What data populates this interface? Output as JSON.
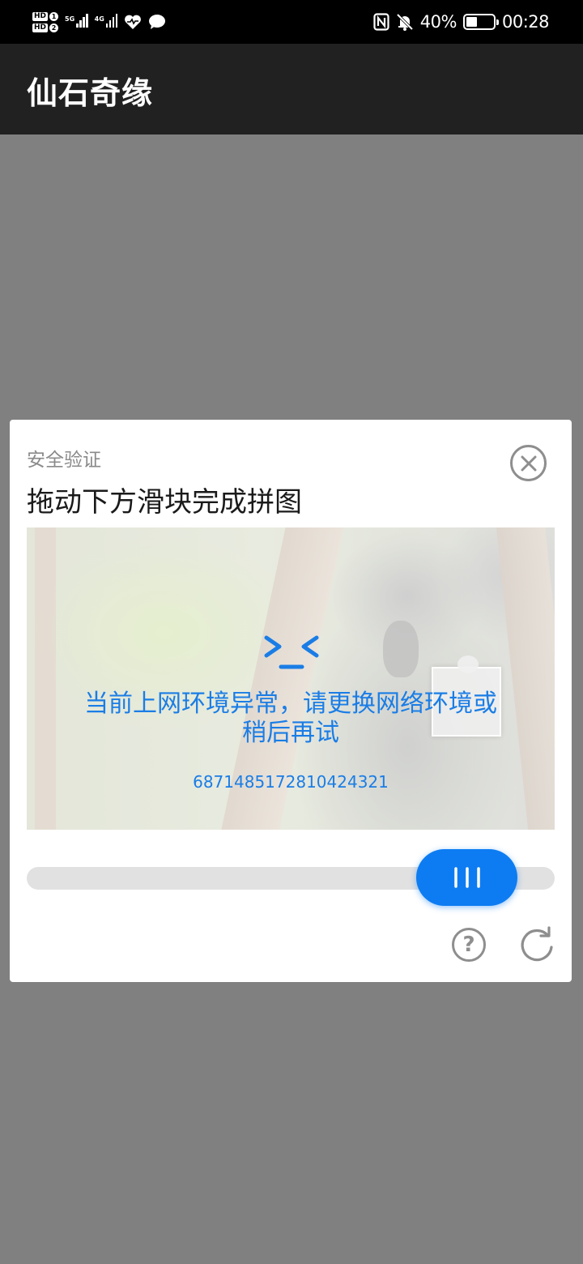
{
  "status_bar": {
    "sim1_label": "HD",
    "sim1_index": "1",
    "sim2_label": "HD",
    "sim2_index": "2",
    "network1": "5G",
    "network2": "4G",
    "icons": [
      "hd-sim-icon",
      "signal-icon",
      "heart-health-icon",
      "chat-bubble-icon",
      "nfc-icon",
      "bell-muted-icon",
      "battery-icon"
    ],
    "battery_percent": "40%",
    "battery_level": 0.4,
    "time": "00:28"
  },
  "app_bar": {
    "title": "仙石奇缘"
  },
  "dialog": {
    "subtitle": "安全验证",
    "title": "拖动下方滑块完成拼图",
    "close_icon": "close-circle-icon",
    "puzzle": {
      "error_face": ">_<",
      "error_message": "当前上网环境异常，请更换网络环境或稍后再试",
      "error_code": "6871485172810424321"
    },
    "slider": {
      "handle_icon": "grip-lines-icon",
      "progress": 0.78
    },
    "help_icon": "question-circle-icon",
    "help_glyph": "?",
    "refresh_icon": "refresh-icon"
  },
  "colors": {
    "overlay": "#808080",
    "app_bar": "#212121",
    "accent": "#0d7cf2",
    "error_text": "#1a7de6",
    "icon_gray": "#8e8e8e"
  }
}
